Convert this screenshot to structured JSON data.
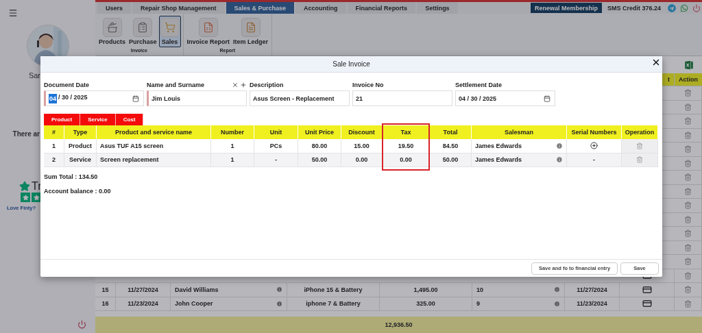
{
  "sidebar": {
    "user_name": "Sar",
    "notice": "There ar",
    "rating_label": "Tr",
    "prompt": "Love Finty?"
  },
  "top_tabs": [
    {
      "label": "Users",
      "selected": false
    },
    {
      "label": "Repair Shop Management",
      "selected": false
    },
    {
      "label": "Sales & Purchase",
      "selected": true
    },
    {
      "label": "Accounting",
      "selected": false
    },
    {
      "label": "Financial Reports",
      "selected": false
    },
    {
      "label": "Settings",
      "selected": false
    }
  ],
  "header_actions": {
    "membership_button": "Renewal Membership",
    "sms_credit": "SMS Credit 376.24"
  },
  "ribbon": {
    "groups": [
      {
        "label": "Invoice",
        "items": [
          {
            "label": "Products",
            "kind": "pot",
            "selected": false
          },
          {
            "label": "Purchase",
            "kind": "list",
            "selected": false
          },
          {
            "label": "Sales",
            "kind": "cart",
            "selected": true
          }
        ]
      },
      {
        "label": "Report",
        "items": [
          {
            "label": "Invoice Report",
            "kind": "chart",
            "selected": false
          },
          {
            "label": "Item Ledger",
            "kind": "ledger",
            "selected": false
          }
        ]
      }
    ]
  },
  "records": {
    "columns": [
      "t",
      "Action"
    ],
    "rows": [
      {
        "kind": "covered"
      },
      {
        "kind": "covered"
      },
      {
        "kind": "covered"
      },
      {
        "kind": "covered"
      },
      {
        "kind": "covered"
      },
      {
        "kind": "covered"
      },
      {
        "kind": "covered"
      },
      {
        "kind": "covered"
      },
      {
        "kind": "covered"
      },
      {
        "kind": "covered"
      },
      {
        "kind": "covered"
      },
      {
        "kind": "covered"
      },
      {
        "kind": "covered"
      },
      {
        "kind": "partial"
      },
      {
        "kind": "full",
        "cells": [
          "15",
          "11/27/2024",
          "David Williams",
          "iPhone 15 & Battery",
          "1,495.00",
          "10",
          "11/27/2024"
        ]
      },
      {
        "kind": "full",
        "cells": [
          "16",
          "11/23/2024",
          "John Cooper",
          "iphone 7 & Battery",
          "325.00",
          "9",
          "11/23/2024"
        ]
      }
    ],
    "total": "12,936.50"
  },
  "dialog": {
    "title": "Sale Invoice",
    "fields": [
      {
        "label": "Document Date",
        "kind": "date",
        "required": true,
        "parts": [
          {
            "text": "04",
            "selected": true
          },
          {
            "text": "/ 30 / 2025",
            "selected": false
          }
        ]
      },
      {
        "label": "Name and Surname",
        "kind": "person",
        "required": true,
        "parts": [
          {
            "text": "Jim Louis",
            "selected": false
          }
        ]
      },
      {
        "label": "Description",
        "kind": "text",
        "required": false,
        "parts": [
          {
            "text": "Asus Screen - Replacement",
            "selected": false
          }
        ]
      },
      {
        "label": "Invoice No",
        "kind": "text",
        "required": false,
        "parts": [
          {
            "text": "21",
            "selected": false
          }
        ]
      },
      {
        "label": "Settlement Date",
        "kind": "date",
        "required": false,
        "parts": [
          {
            "text": "04 / 30 / 2025",
            "selected": false
          }
        ]
      }
    ],
    "item_tabs": [
      "Product",
      "Service",
      "Cost"
    ],
    "columns": [
      {
        "label": "#",
        "highlighted": false
      },
      {
        "label": "Type",
        "highlighted": false
      },
      {
        "label": "Product and service name",
        "highlighted": false
      },
      {
        "label": "Number",
        "highlighted": false
      },
      {
        "label": "Unit",
        "highlighted": false
      },
      {
        "label": "Unit Price",
        "highlighted": false
      },
      {
        "label": "Discount",
        "highlighted": false
      },
      {
        "label": "Tax",
        "highlighted": true
      },
      {
        "label": "Total",
        "highlighted": false
      },
      {
        "label": "Salesman",
        "highlighted": false
      },
      {
        "label": "Serial Numbers",
        "highlighted": false
      },
      {
        "label": "Operation",
        "highlighted": false
      }
    ],
    "rows": [
      {
        "cells": [
          "1",
          "Product",
          "Asus TUF A15 screen",
          "1",
          "PCs",
          "80.00",
          "15.00",
          "19.50",
          "84.50"
        ],
        "salesman": "James Edwards",
        "serial": {
          "kind": "add"
        }
      },
      {
        "cells": [
          "2",
          "Service",
          "Screen replacement",
          "1",
          "-",
          "50.00",
          "0.00",
          "0.00",
          "50.00"
        ],
        "salesman": "James Edwards",
        "serial": {
          "kind": "text",
          "text": "-"
        }
      }
    ],
    "summary": [
      "Sum Total : 134.50",
      "Account balance : 0.00"
    ],
    "buttons": [
      "Save and fo to financial entry",
      "Save"
    ]
  }
}
